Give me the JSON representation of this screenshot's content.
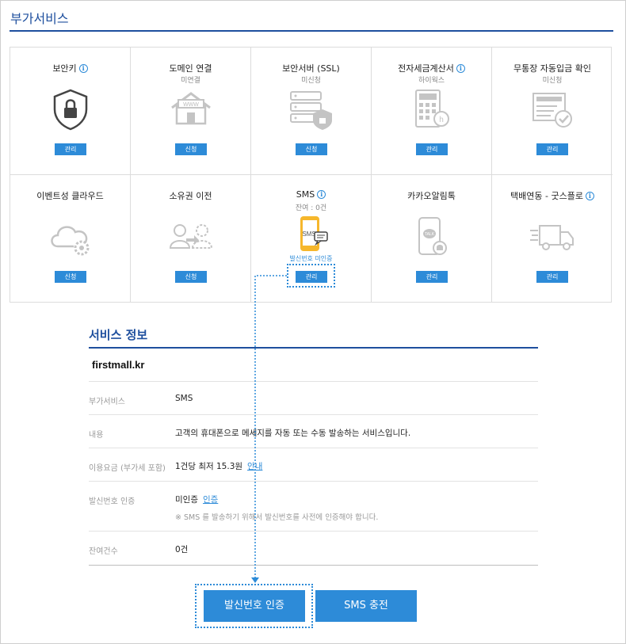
{
  "page": {
    "title": "부가서비스"
  },
  "services": [
    {
      "title": "보안키",
      "subtitle": "",
      "info": true,
      "button": "관리",
      "icon": "security-shield-lock-icon"
    },
    {
      "title": "도메인 연결",
      "subtitle": "미연결",
      "info": false,
      "button": "신청",
      "icon": "www-house-icon"
    },
    {
      "title": "보안서버 (SSL)",
      "subtitle": "미신청",
      "info": false,
      "button": "신청",
      "icon": "server-lock-icon"
    },
    {
      "title": "전자세금계산서",
      "subtitle": "하이웍스",
      "info": true,
      "button": "관리",
      "icon": "calculator-icon"
    },
    {
      "title": "무통장 자동입금 확인",
      "subtitle": "미신청",
      "info": false,
      "button": "관리",
      "icon": "bankbook-check-icon"
    },
    {
      "title": "이벤트성 클라우드",
      "subtitle": "",
      "info": false,
      "button": "신청",
      "icon": "cloud-gear-icon"
    },
    {
      "title": "소유권 이전",
      "subtitle": "",
      "info": false,
      "button": "신청",
      "icon": "users-transfer-icon"
    },
    {
      "title": "SMS",
      "subtitle": "잔여 : 0건",
      "info": true,
      "button": "관리",
      "icon": "sms-phone-icon",
      "link": "발신번호 미인증"
    },
    {
      "title": "카카오알림톡",
      "subtitle": "",
      "info": false,
      "button": "관리",
      "icon": "kakao-talk-phone-icon"
    },
    {
      "title": "택배연동 - 굿스플로",
      "subtitle": "",
      "info": true,
      "button": "관리",
      "icon": "delivery-truck-icon"
    }
  ],
  "service_info": {
    "title": "서비스 정보",
    "domain": "firstmall.kr",
    "rows": {
      "addon_label": "부가서비스",
      "addon_value": "SMS",
      "content_label": "내용",
      "content_value": "고객의 휴대폰으로 메세지를 자동 또는 수동 발송하는 서비스입니다.",
      "fee_label": "이용요금 (부가세 포함)",
      "fee_value": "1건당 최저 15.3원",
      "fee_link": "안내",
      "auth_label": "발신번호 인증",
      "auth_value": "미인증",
      "auth_link": "인증",
      "auth_note": "※ SMS 를 발송하기 위해서 발신번호를 사전에 인증해야 합니다.",
      "remain_label": "잔여건수",
      "remain_value": "0건"
    }
  },
  "actions": {
    "verify_button": "발신번호 인증",
    "charge_button": "SMS 충전"
  },
  "colors": {
    "accent": "#2d8bd8",
    "title": "#1e4f9e",
    "icon_gray": "#c4c4c4",
    "icon_dark": "#444444",
    "sms_phone": "#f6b72c"
  }
}
